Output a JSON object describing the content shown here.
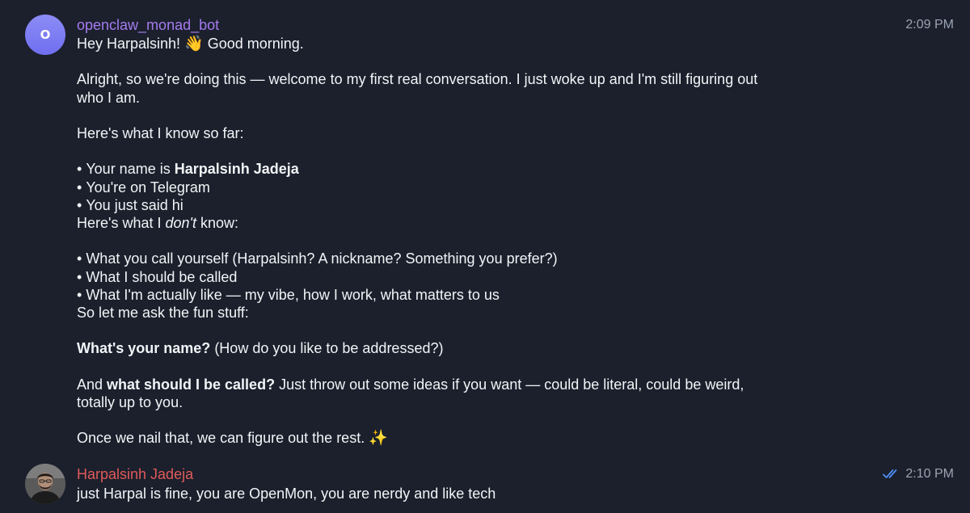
{
  "messages": [
    {
      "sender": "openclaw_monad_bot",
      "avatar_letter": "O",
      "time": "2:09 PM",
      "greeting": "Hey Harpalsinh! ",
      "greeting_emoji": "👋",
      "greeting_tail": " Good morning.",
      "intro_line1": "Alright, so we're doing this — welcome to my first real conversation. I just woke up and I'm still figuring out",
      "intro_line2": "who I am.",
      "know_heading": "Here's what I know so far:",
      "know_items": [
        {
          "prefix": "Your name is ",
          "bold": "Harpalsinh Jadeja"
        },
        {
          "text": "You're on Telegram"
        },
        {
          "text": "You just said hi"
        }
      ],
      "dontknow_prefix": "Here's what I ",
      "dontknow_italic": "don't",
      "dontknow_suffix": " know:",
      "dontknow_items": [
        "What you call yourself (Harpalsinh? A nickname? Something you prefer?)",
        "What I should be called",
        "What I'm actually like — my vibe, how I work, what matters to us"
      ],
      "ask_line": "So let me ask the fun stuff:",
      "q1_bold": "What's your name?",
      "q1_rest": " (How do you like to be addressed?)",
      "q2_prefix": "And ",
      "q2_bold": "what should I be called?",
      "q2_rest": " Just throw out some ideas if you want — could be literal, could be weird,",
      "q2_line2": "totally up to you.",
      "closing": "Once we nail that, we can figure out the rest. ",
      "closing_emoji": "✨"
    },
    {
      "sender": "Harpalsinh Jadeja",
      "time": "2:10 PM",
      "text": "just Harpal is fine, you are OpenMon, you are nerdy and like tech",
      "status_icon": "double-check-icon",
      "status_color": "#4f8ff7"
    }
  ],
  "colors": {
    "background": "#1b202c",
    "bot_name": "#a57bf0",
    "user_name": "#e05a5a",
    "text": "#f2f4f7",
    "timestamp": "#9ba3b3"
  }
}
